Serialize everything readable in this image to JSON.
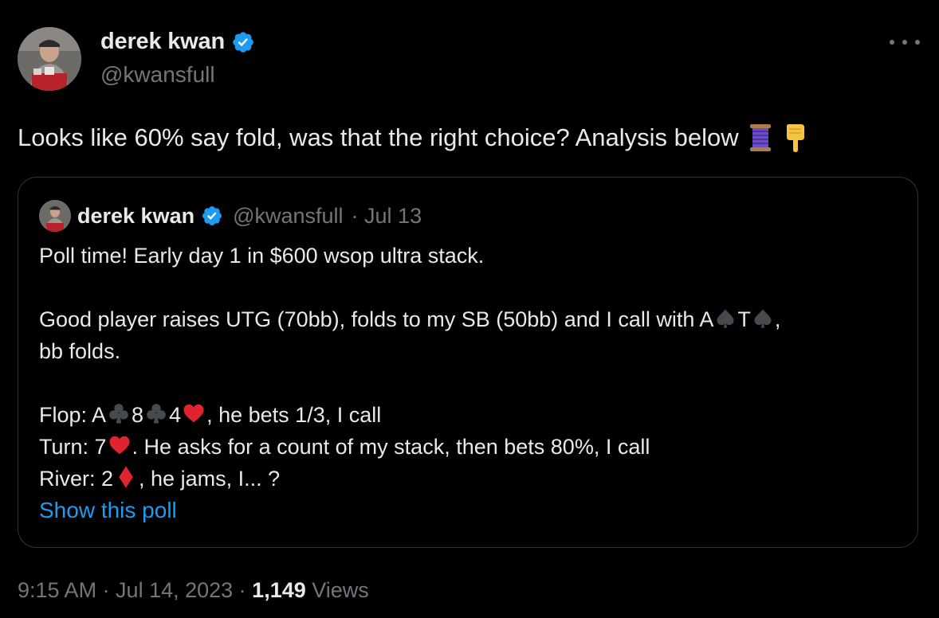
{
  "author": {
    "name": "derek kwan",
    "handle": "@kwansfull"
  },
  "tweet": {
    "text": "Looks like 60% say fold, was that the right choice? Analysis below",
    "emoji_names": [
      "spool-of-thread-emoji",
      "backhand-index-pointing-down-emoji"
    ]
  },
  "quote": {
    "name": "derek kwan",
    "handle": "@kwansfull",
    "date": "· Jul 13",
    "line1": "Poll time! Early day 1 in $600 wsop ultra stack.",
    "line2a": "Good player raises UTG (70bb), folds to my SB (50bb) and I call with A",
    "line2b": "T",
    "line2c": ",",
    "line3": "bb folds.",
    "flop_prefix": "Flop: A",
    "flop_8": "8",
    "flop_4": "4",
    "flop_suffix": ", he bets 1/3, I call",
    "turn_prefix": "Turn: 7",
    "turn_suffix": ". He asks for a count of my stack, then bets 80%, I call",
    "river_prefix": "River: 2",
    "river_suffix": ", he jams, I... ?",
    "show_poll": "Show this poll"
  },
  "footer": {
    "time": "9:15 AM · Jul 14, 2023 · ",
    "views_count": "1,149",
    "views_label": " Views"
  },
  "colors": {
    "background": "#000000",
    "text": "#e7e9ea",
    "muted": "#71767b",
    "link": "#1d9bf0",
    "verified": "#1d9bf0",
    "heart_red": "#e0242f",
    "border": "#2f3336"
  }
}
